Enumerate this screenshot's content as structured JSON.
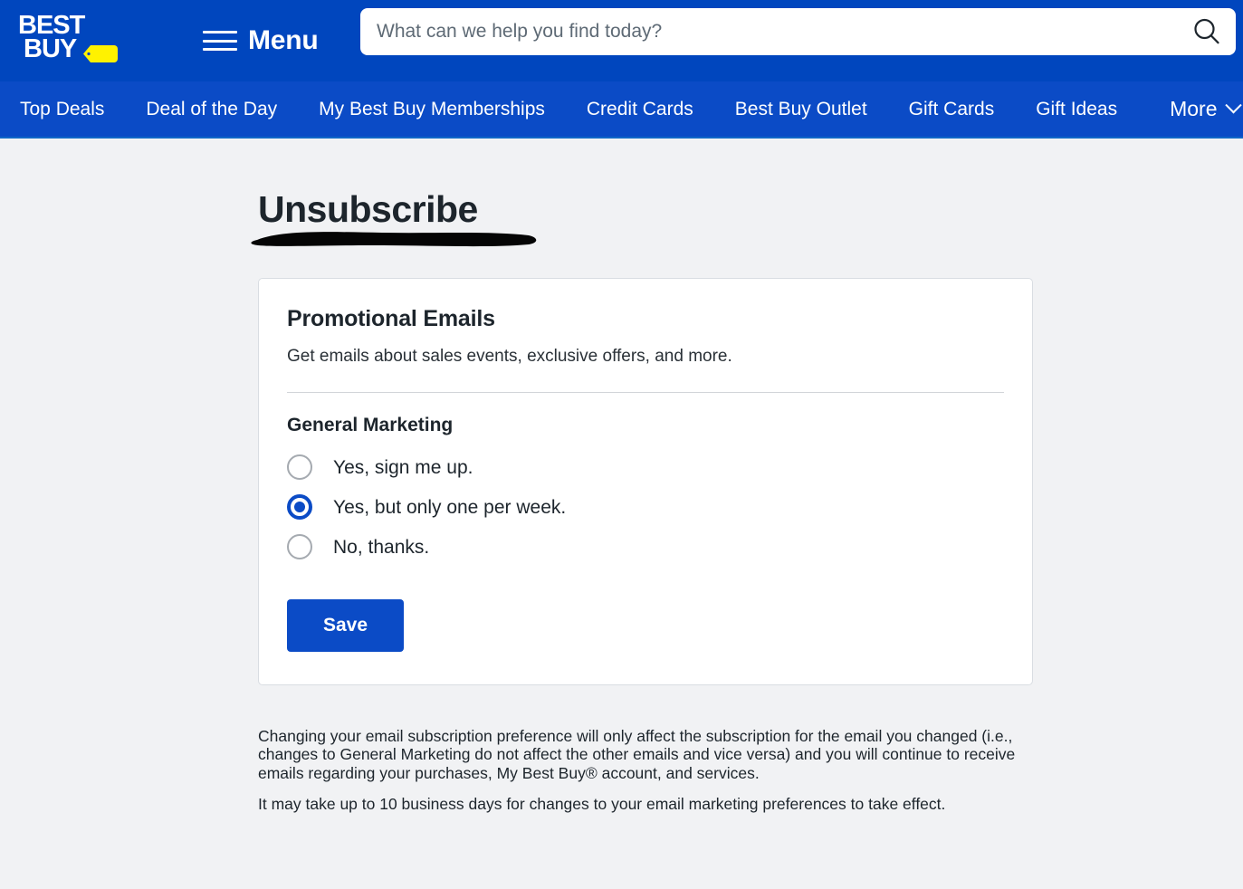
{
  "brand": {
    "logo_line1": "BEST",
    "logo_line2": "BUY",
    "accent_blue": "#0046be",
    "nav_blue": "#0b4bc6",
    "tag_yellow": "#fff200"
  },
  "header": {
    "menu_label": "Menu",
    "search": {
      "placeholder": "What can we help you find today?",
      "value": "",
      "button_icon": "search-icon"
    }
  },
  "nav": {
    "items": [
      {
        "label": "Top Deals"
      },
      {
        "label": "Deal of the Day"
      },
      {
        "label": "My Best Buy Memberships"
      },
      {
        "label": "Credit Cards"
      },
      {
        "label": "Best Buy Outlet"
      },
      {
        "label": "Gift Cards"
      },
      {
        "label": "Gift Ideas"
      }
    ],
    "more": {
      "label": "More",
      "icon": "chevron-down-icon"
    }
  },
  "page": {
    "title": "Unsubscribe",
    "redaction": {
      "type": "marker-redaction",
      "color": "#000000"
    }
  },
  "card": {
    "title": "Promotional Emails",
    "subtitle": "Get emails about sales events, exclusive offers, and more.",
    "group_title": "General Marketing",
    "options": [
      {
        "label": "Yes, sign me up.",
        "selected": false
      },
      {
        "label": "Yes, but only one per week.",
        "selected": true
      },
      {
        "label": "No, thanks.",
        "selected": false
      }
    ],
    "save_label": "Save"
  },
  "footnotes": [
    {
      "text": "Changing your email subscription preference will only affect the subscription for the email you changed (i.e., changes to General Marketing do not affect the other emails and vice versa) and you will continue to receive emails regarding your purchases, My Best Buy® account, and services."
    },
    {
      "text": "It may take up to 10 business days for changes to your email marketing preferences to take effect."
    }
  ]
}
